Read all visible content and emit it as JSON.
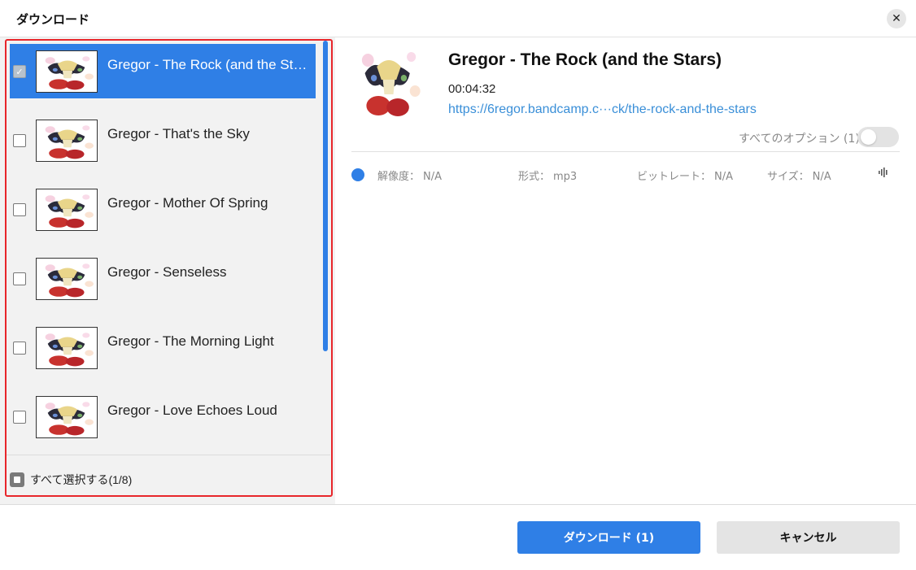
{
  "dialog": {
    "title": "ダウンロード",
    "close_icon": "close-icon"
  },
  "list": {
    "items": [
      {
        "label": "Gregor - The Rock (and the Stars)",
        "checked": true
      },
      {
        "label": "Gregor - That's the Sky",
        "checked": false
      },
      {
        "label": "Gregor - Mother Of Spring",
        "checked": false
      },
      {
        "label": "Gregor - Senseless",
        "checked": false
      },
      {
        "label": "Gregor - The Morning Light",
        "checked": false
      },
      {
        "label": "Gregor - Love Echoes Loud",
        "checked": false
      }
    ],
    "select_all_label": "すべて選択する(1/8)"
  },
  "detail": {
    "title": "Gregor - The Rock (and the Stars)",
    "duration": "00:04:32",
    "url": "https://6regor.bandcamp.c···ck/the-rock-and-the-stars",
    "options_label": "すべてのオプション (1)",
    "format_row": {
      "resolution_label": "解像度：",
      "resolution_value": "N/A",
      "format_label": "形式：",
      "format_value": "mp3",
      "bitrate_label": "ビットレート：",
      "bitrate_value": "N/A",
      "size_label": "サイズ：",
      "size_value": "N/A",
      "audio_icon": "audio-wave-icon"
    }
  },
  "footer": {
    "download_label": "ダウンロード (1)",
    "cancel_label": "キャンセル"
  },
  "colors": {
    "accent": "#2f7fe6",
    "highlight_border": "#e8262b",
    "link": "#3a8fd8"
  }
}
